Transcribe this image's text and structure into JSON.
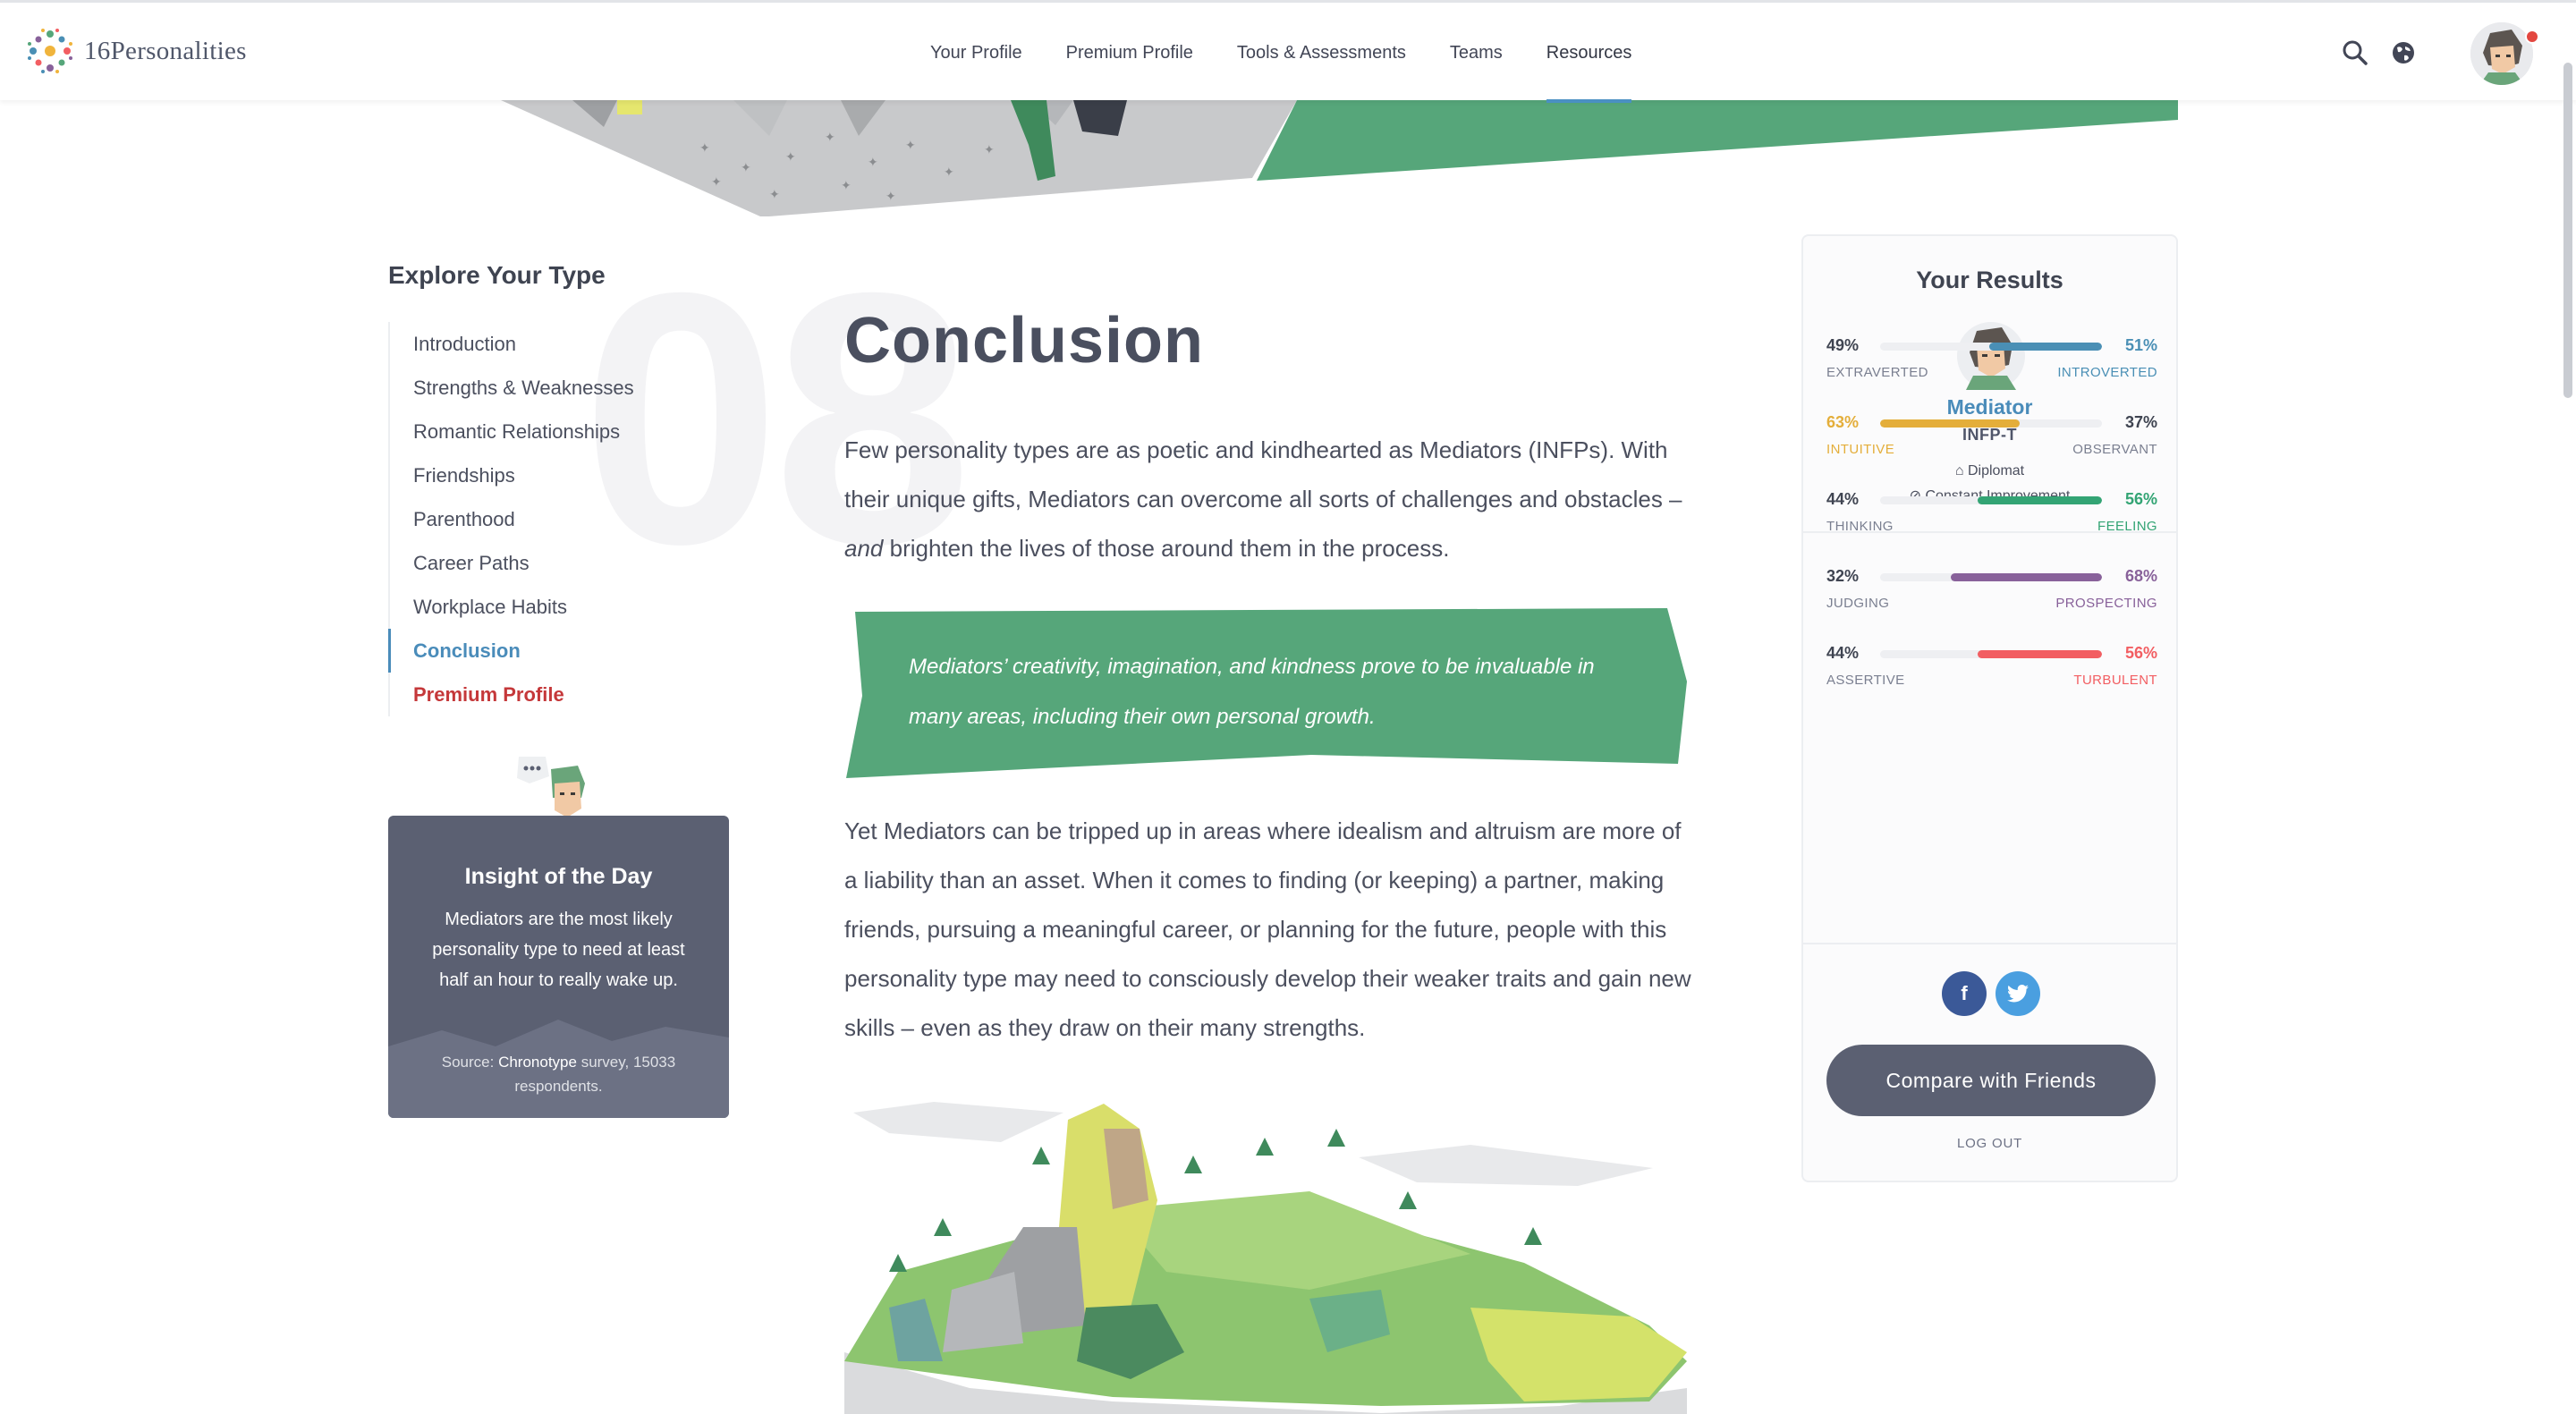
{
  "brand": {
    "name": "16Personalities"
  },
  "nav": {
    "items": [
      {
        "label": "Your Profile"
      },
      {
        "label": "Premium Profile"
      },
      {
        "label": "Tools & Assessments"
      },
      {
        "label": "Teams"
      },
      {
        "label": "Resources"
      }
    ],
    "active": "Resources",
    "icons": [
      "search-icon",
      "globe-icon"
    ],
    "notification_dot": true
  },
  "sidebar": {
    "title": "Explore Your Type",
    "section_number": "08",
    "items": [
      {
        "label": "Introduction"
      },
      {
        "label": "Strengths & Weaknesses"
      },
      {
        "label": "Romantic Relationships"
      },
      {
        "label": "Friendships"
      },
      {
        "label": "Parenthood"
      },
      {
        "label": "Career Paths"
      },
      {
        "label": "Workplace Habits"
      },
      {
        "label": "Conclusion"
      },
      {
        "label": "Premium Profile"
      }
    ],
    "active": "Conclusion"
  },
  "insight": {
    "title": "Insight of the Day",
    "text": "Mediators are the most likely personality type to need at least half an hour to really wake up.",
    "source_prefix": "Source: ",
    "source_link": "Chronotype",
    "source_suffix": " survey, 15033 respondents."
  },
  "main": {
    "title": "Conclusion",
    "para1_a": "Few personality types are as poetic and kindhearted as Mediators (INFPs). With their unique gifts, Mediators can overcome all sorts of challenges and obstacles – ",
    "para1_em": "and",
    "para1_b": " brighten the lives of those around them in the process.",
    "quote": "Mediators’ creativity, imagination, and kindness prove to be invaluable in many areas, including their own personal growth.",
    "para2": "Yet Mediators can be tripped up in areas where idealism and altruism are more of a liability than an asset. When it comes to finding (or keeping) a partner, making friends, pursuing a meaningful career, or planning for the future, people with this personality type may need to consciously develop their weaker traits and gain new skills – even as they draw on their many strengths."
  },
  "results": {
    "title": "Your Results",
    "type_name": "Mediator",
    "type_code": "INFP-T",
    "role": "Diplomat",
    "strategy": "Constant Improvement",
    "traits": [
      {
        "left_pct": "49%",
        "right_pct": "51%",
        "left_label": "EXTRAVERTED",
        "right_label": "INTROVERTED",
        "dominant": "right",
        "fill_fraction": 0.51,
        "color": "#4a8fb5"
      },
      {
        "left_pct": "63%",
        "right_pct": "37%",
        "left_label": "INTUITIVE",
        "right_label": "OBSERVANT",
        "dominant": "left",
        "fill_fraction": 0.63,
        "color": "#e4ae3a"
      },
      {
        "left_pct": "44%",
        "right_pct": "56%",
        "left_label": "THINKING",
        "right_label": "FEELING",
        "dominant": "right",
        "fill_fraction": 0.56,
        "color": "#33a474"
      },
      {
        "left_pct": "32%",
        "right_pct": "68%",
        "left_label": "JUDGING",
        "right_label": "PROSPECTING",
        "dominant": "right",
        "fill_fraction": 0.68,
        "color": "#88619a"
      },
      {
        "left_pct": "44%",
        "right_pct": "56%",
        "left_label": "ASSERTIVE",
        "right_label": "TURBULENT",
        "dominant": "right",
        "fill_fraction": 0.56,
        "color": "#f25e62"
      }
    ],
    "share": [
      "facebook-icon",
      "twitter-icon"
    ],
    "compare_button": "Compare with Friends",
    "logout": "LOG OUT"
  },
  "colors": {
    "accent_blue": "#4a8cba",
    "premium_red": "#c5383a",
    "quote_green": "#56a67a",
    "dark_slate": "#5b6072"
  }
}
